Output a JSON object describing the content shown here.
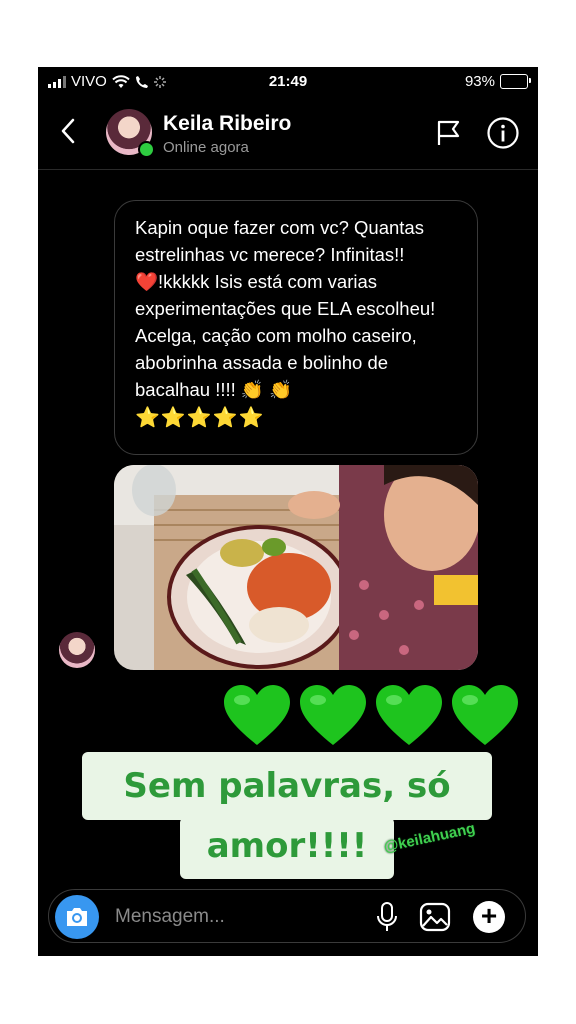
{
  "status_bar": {
    "carrier": "VIVO",
    "time": "21:49",
    "battery": "93%",
    "battery_level": 0.93
  },
  "header": {
    "contact_name": "Keila Ribeiro",
    "presence": "Online agora",
    "icons": [
      "chevron-left-icon",
      "flag-icon",
      "info-icon"
    ]
  },
  "message": {
    "text": "Kapin oque fazer com vc? Quantas estrelinhas vc merece? Infinitas!!❤️!kkkkk  Isis está com varias experimentações que ELA escolheu! Acelga, cação com molho caseiro, abobrinha assada e bolinho de bacalhau !!!! 👏 👏",
    "stars": "⭐⭐⭐⭐⭐"
  },
  "reactions": {
    "hearts_count": 4,
    "heart_color": "#1ec41e"
  },
  "overlay": {
    "line1": "Sem palavras, só",
    "line2": "amor!!!!",
    "handle": "@keilahuang",
    "text_color": "#2e9a3a",
    "background": "#e9f5e6"
  },
  "composer": {
    "placeholder": "Mensagem...",
    "icons": [
      "camera-icon",
      "microphone-icon",
      "gallery-icon",
      "plus-icon"
    ]
  },
  "colors": {
    "accent_blue": "#3897f0",
    "online_green": "#2ecc40"
  }
}
